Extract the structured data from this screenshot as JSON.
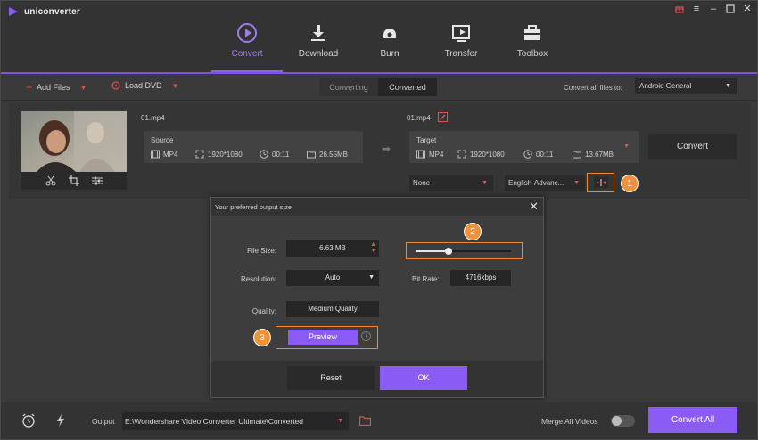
{
  "app": {
    "title": "uniconverter"
  },
  "nav": [
    {
      "label": "Convert",
      "icon": "convert-icon",
      "active": true
    },
    {
      "label": "Download",
      "icon": "download-icon"
    },
    {
      "label": "Burn",
      "icon": "burn-icon"
    },
    {
      "label": "Transfer",
      "icon": "transfer-icon"
    },
    {
      "label": "Toolbox",
      "icon": "toolbox-icon"
    }
  ],
  "toolbar": {
    "add_files": "Add Files",
    "load_dvd": "Load DVD",
    "tabs": [
      "Converting",
      "Converted"
    ],
    "convert_all_to": "Convert all files to:",
    "format": "Android General"
  },
  "file": {
    "source_name": "01.mp4",
    "target_name": "01.mp4",
    "source": {
      "title": "Source",
      "format": "MP4",
      "resolution": "1920*1080",
      "duration": "00:11",
      "size": "26.55MB"
    },
    "target": {
      "title": "Target",
      "format": "MP4",
      "resolution": "1920*1080",
      "duration": "00:11",
      "size": "13.67MB"
    },
    "convert_label": "Convert",
    "subtitle": "None",
    "audio": "English-Advanc..."
  },
  "badges": [
    "1",
    "2",
    "3"
  ],
  "dialog": {
    "title": "Your preferred output size",
    "file_size_label": "File Size:",
    "file_size_value": "6.63  MB",
    "resolution_label": "Resolution:",
    "resolution_value": "Auto",
    "bit_rate_label": "Bit Rate:",
    "bit_rate_value": "4716kbps",
    "quality_label": "Quality:",
    "quality_value": "Medium Quality",
    "preview_label": "Preview",
    "reset_label": "Reset",
    "ok_label": "OK",
    "slider_fraction": 0.34
  },
  "bottom": {
    "output_label": "Output",
    "output_path": "E:\\Wondershare Video Converter Ultimate\\Converted",
    "merge_label": "Merge All Videos",
    "convert_all_label": "Convert All"
  },
  "colors": {
    "accent": "#8a5cf5",
    "highlight": "#f08a2a",
    "caret": "#e0524a"
  }
}
